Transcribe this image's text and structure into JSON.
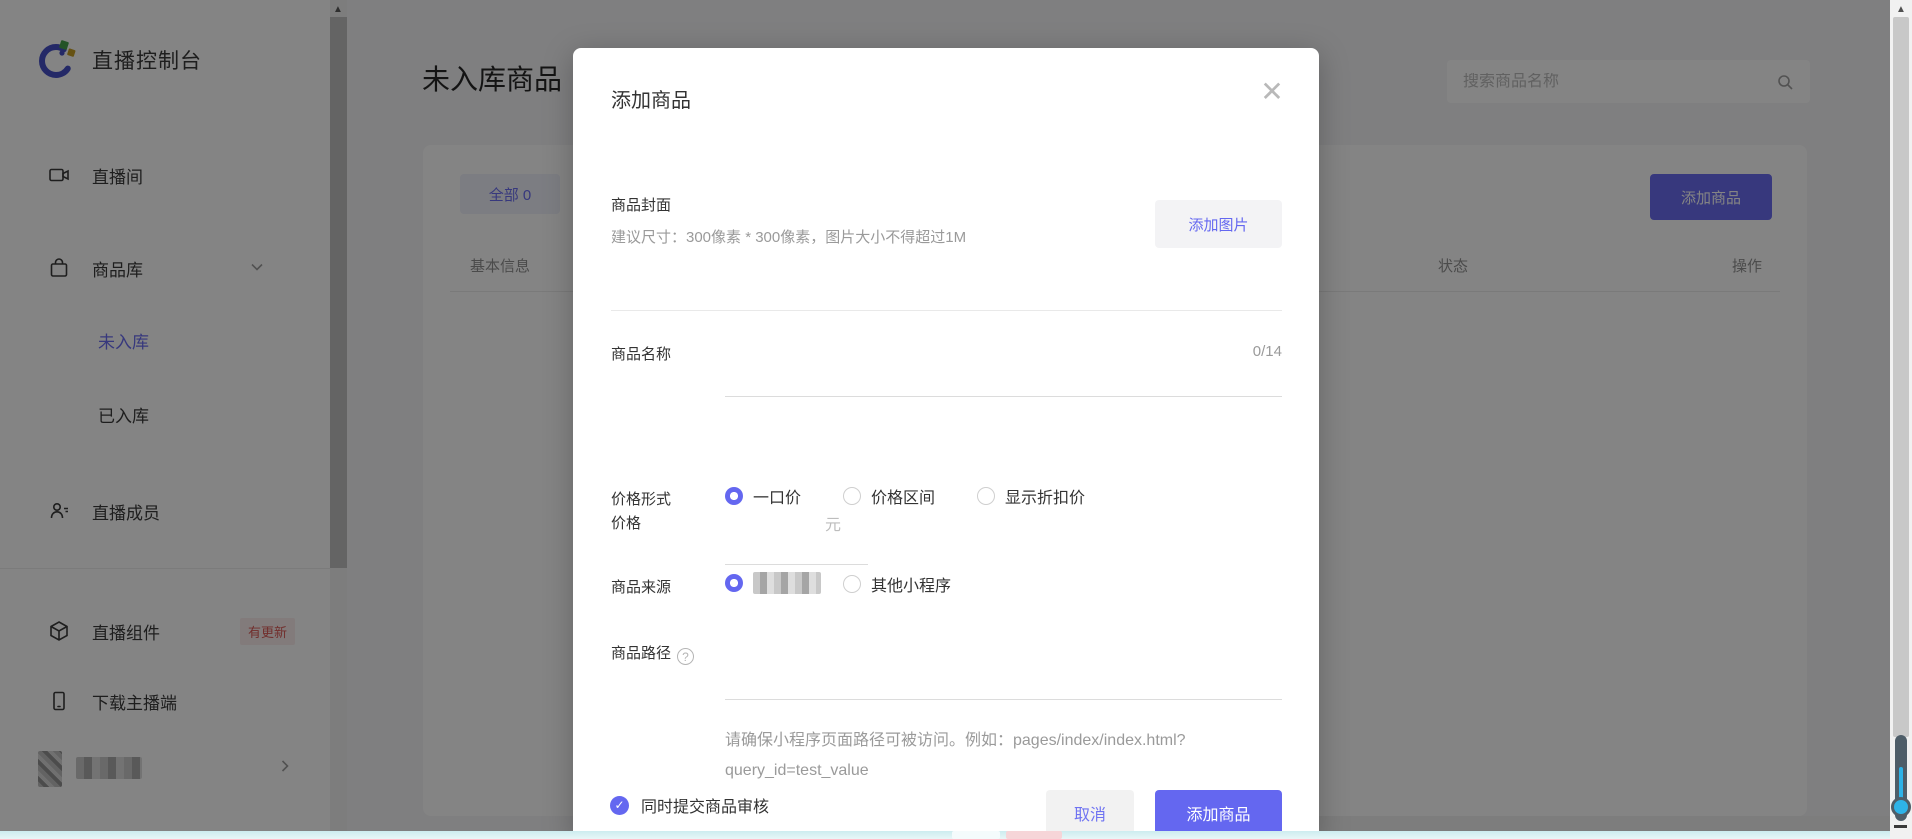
{
  "accent": "#6467f0",
  "badge_red": "#d9534f",
  "sidebar": {
    "title": "直播控制台",
    "items": [
      {
        "label": "直播间"
      },
      {
        "label": "商品库"
      },
      {
        "label": "未入库"
      },
      {
        "label": "已入库"
      },
      {
        "label": "直播成员"
      },
      {
        "label": "直播组件",
        "badge": "有更新"
      },
      {
        "label": "下载主播端"
      }
    ]
  },
  "main": {
    "page_title": "未入库商品",
    "search_placeholder": "搜索商品名称",
    "tab_all": "全部 0",
    "add_button": "添加商品",
    "table_headers": [
      "基本信息",
      "状态",
      "操作"
    ]
  },
  "modal": {
    "title": "添加商品",
    "cover": {
      "label": "商品封面",
      "hint": "建议尺寸：300像素 * 300像素，图片大小不得超过1M",
      "add_image_button": "添加图片"
    },
    "name": {
      "label": "商品名称",
      "counter": "0/14",
      "value": ""
    },
    "price_type": {
      "label": "价格形式",
      "options": [
        {
          "label": "一口价",
          "selected": true
        },
        {
          "label": "价格区间",
          "selected": false
        },
        {
          "label": "显示折扣价",
          "selected": false
        }
      ]
    },
    "price": {
      "label": "价格",
      "unit": "元",
      "value": ""
    },
    "source": {
      "label": "商品来源",
      "option_other": "其他小程序"
    },
    "path": {
      "label": "商品路径",
      "help_icon": "?",
      "help": "请确保小程序页面路径可被访问。例如：pages/index/index.html?query_id=test_value",
      "value": ""
    },
    "submit_review_label": "同时提交商品审核",
    "cancel_button": "取消",
    "confirm_button": "添加商品"
  }
}
